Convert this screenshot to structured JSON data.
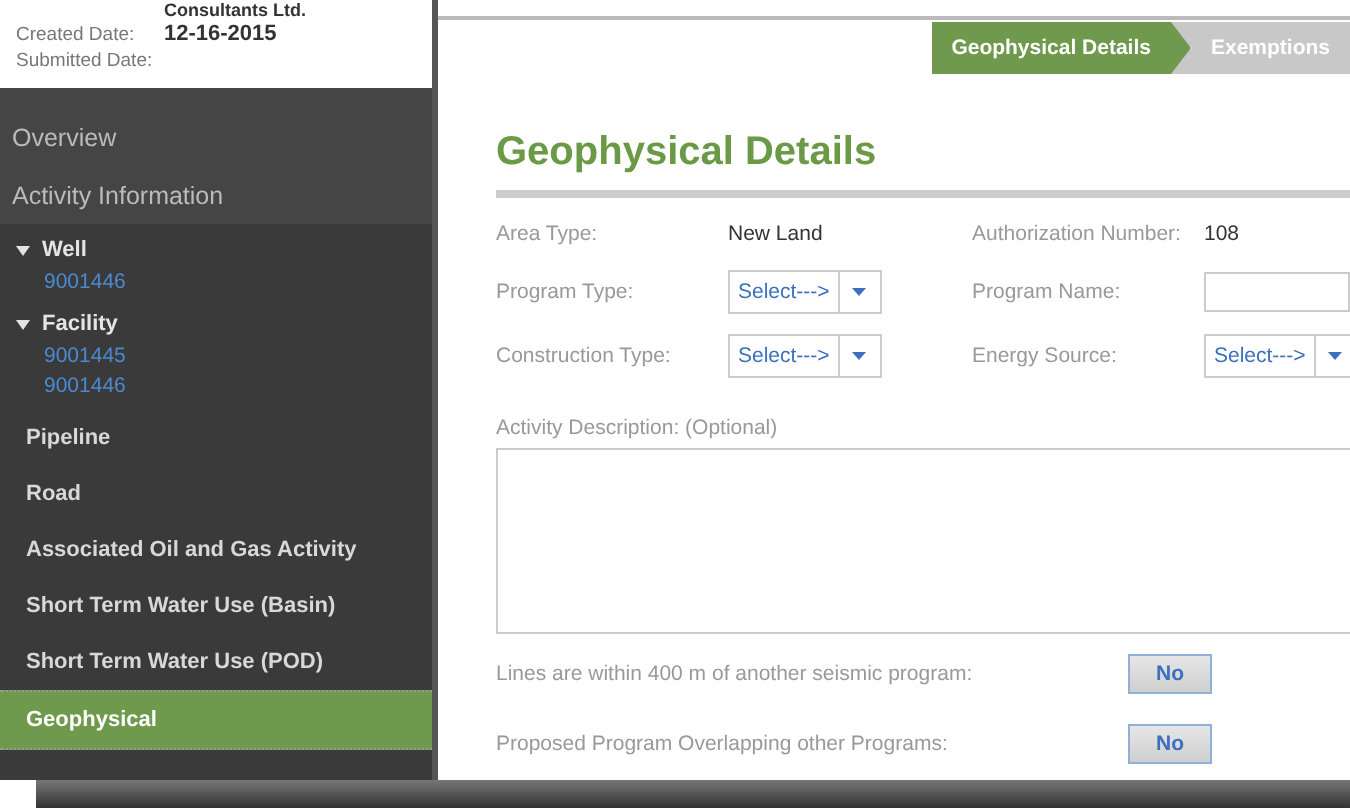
{
  "header": {
    "company": "Consultants Ltd.",
    "created_label": "Created Date:",
    "created_value": "12-16-2015",
    "submitted_label": "Submitted Date:"
  },
  "sidebar": {
    "sections": [
      {
        "label": "Overview",
        "selected": false
      },
      {
        "label": "Activity Information",
        "selected": false
      }
    ],
    "items": [
      {
        "label": "Well",
        "expanded": true,
        "children": [
          {
            "label": "9001446"
          }
        ]
      },
      {
        "label": "Facility",
        "expanded": true,
        "children": [
          {
            "label": "9001445"
          },
          {
            "label": "9001446"
          }
        ]
      },
      {
        "label": "Pipeline",
        "selected": false
      },
      {
        "label": "Road",
        "selected": false
      },
      {
        "label": "Associated Oil and Gas Activity",
        "selected": false
      },
      {
        "label": "Short Term Water Use (Basin)",
        "selected": false
      },
      {
        "label": "Short Term Water Use (POD)",
        "selected": false
      },
      {
        "label": "Geophysical",
        "selected": true
      }
    ]
  },
  "steps": [
    {
      "label": "Geophysical Details",
      "selected": true
    },
    {
      "label": "Exemptions",
      "selected": false
    }
  ],
  "title": "Geophysical Details",
  "fields": [
    [
      {
        "label": "Area Type:",
        "kind": "text",
        "value": "New Land"
      },
      {
        "label": "Authorization Number:",
        "kind": "text",
        "value": "108"
      }
    ],
    [
      {
        "label": "Program Type:",
        "kind": "select",
        "value": "Select--->"
      },
      {
        "label": "Program Name:",
        "kind": "input"
      }
    ],
    [
      {
        "label": "Construction Type:",
        "kind": "select",
        "value": "Select--->"
      },
      {
        "label": "Energy Source:",
        "kind": "select",
        "value": "Select--->"
      }
    ]
  ],
  "description": {
    "label": "Activity Description: (Optional)"
  },
  "questions": [
    {
      "label": "Lines are within 400 m of another seismic program:",
      "answer": "No"
    },
    {
      "label": "Proposed Program Overlapping other Programs:",
      "answer": "No"
    }
  ]
}
